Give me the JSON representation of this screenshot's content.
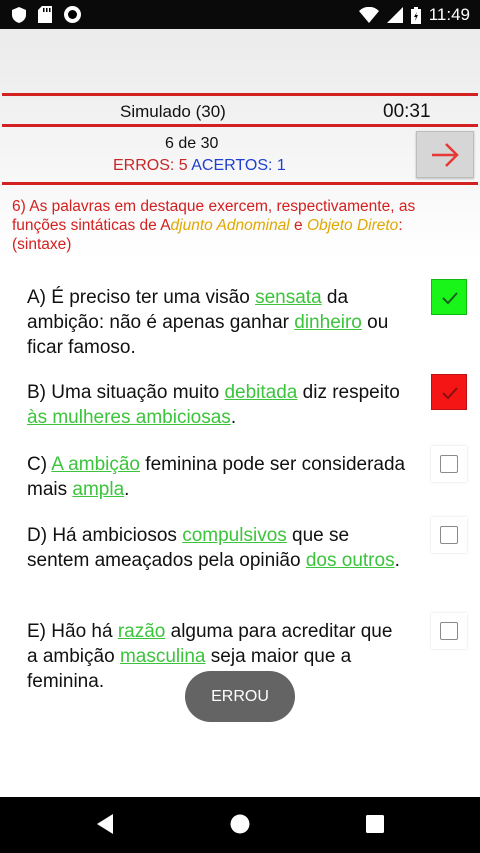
{
  "status_bar": {
    "time": "11:49"
  },
  "header": {
    "title": "Simulado (30)",
    "timer": "00:31"
  },
  "progress": {
    "text": "6 de 30",
    "errors_label": "ERROS: 5",
    "hits_label": "ACERTOS: 1"
  },
  "question": {
    "part1": "6) As palavras em destaque exercem, respectivamente, as funções sintáticas de A",
    "hl1": "djunto Adnominal",
    "part2": " e ",
    "hl2": "Objeto Direto",
    "part3": ": (sintaxe)"
  },
  "options": [
    {
      "a": "A) É preciso ter uma visão ",
      "b": "sensata",
      "c": " da ambição: não é apenas ganhar ",
      "d": "dinheiro",
      "e": " ou ficar famoso."
    },
    {
      "a": "B) Uma situação muito ",
      "b": "debitada",
      "c": " diz respeito ",
      "d": "às mulheres ambiciosas",
      "e": "."
    },
    {
      "a": "C) ",
      "b": "A ambição",
      "c": " feminina pode ser considerada mais ",
      "d": "ampla",
      "e": "."
    },
    {
      "a": "D) Há ambiciosos ",
      "b": "compulsivos",
      "c": " que se sentem ameaçados pela opinião ",
      "d": "dos outros",
      "e": "."
    },
    {
      "a": "E) Hão há ",
      "b": "razão",
      "c": " alguma para acreditar que a ambição ",
      "d": "masculina",
      "e": " seja maior que a feminina."
    }
  ],
  "toast": "ERROU",
  "colors": {
    "accent_red": "#d32020",
    "highlight_green": "#3cc43c",
    "checked_correct": "#19f519",
    "checked_wrong": "#f51515"
  }
}
